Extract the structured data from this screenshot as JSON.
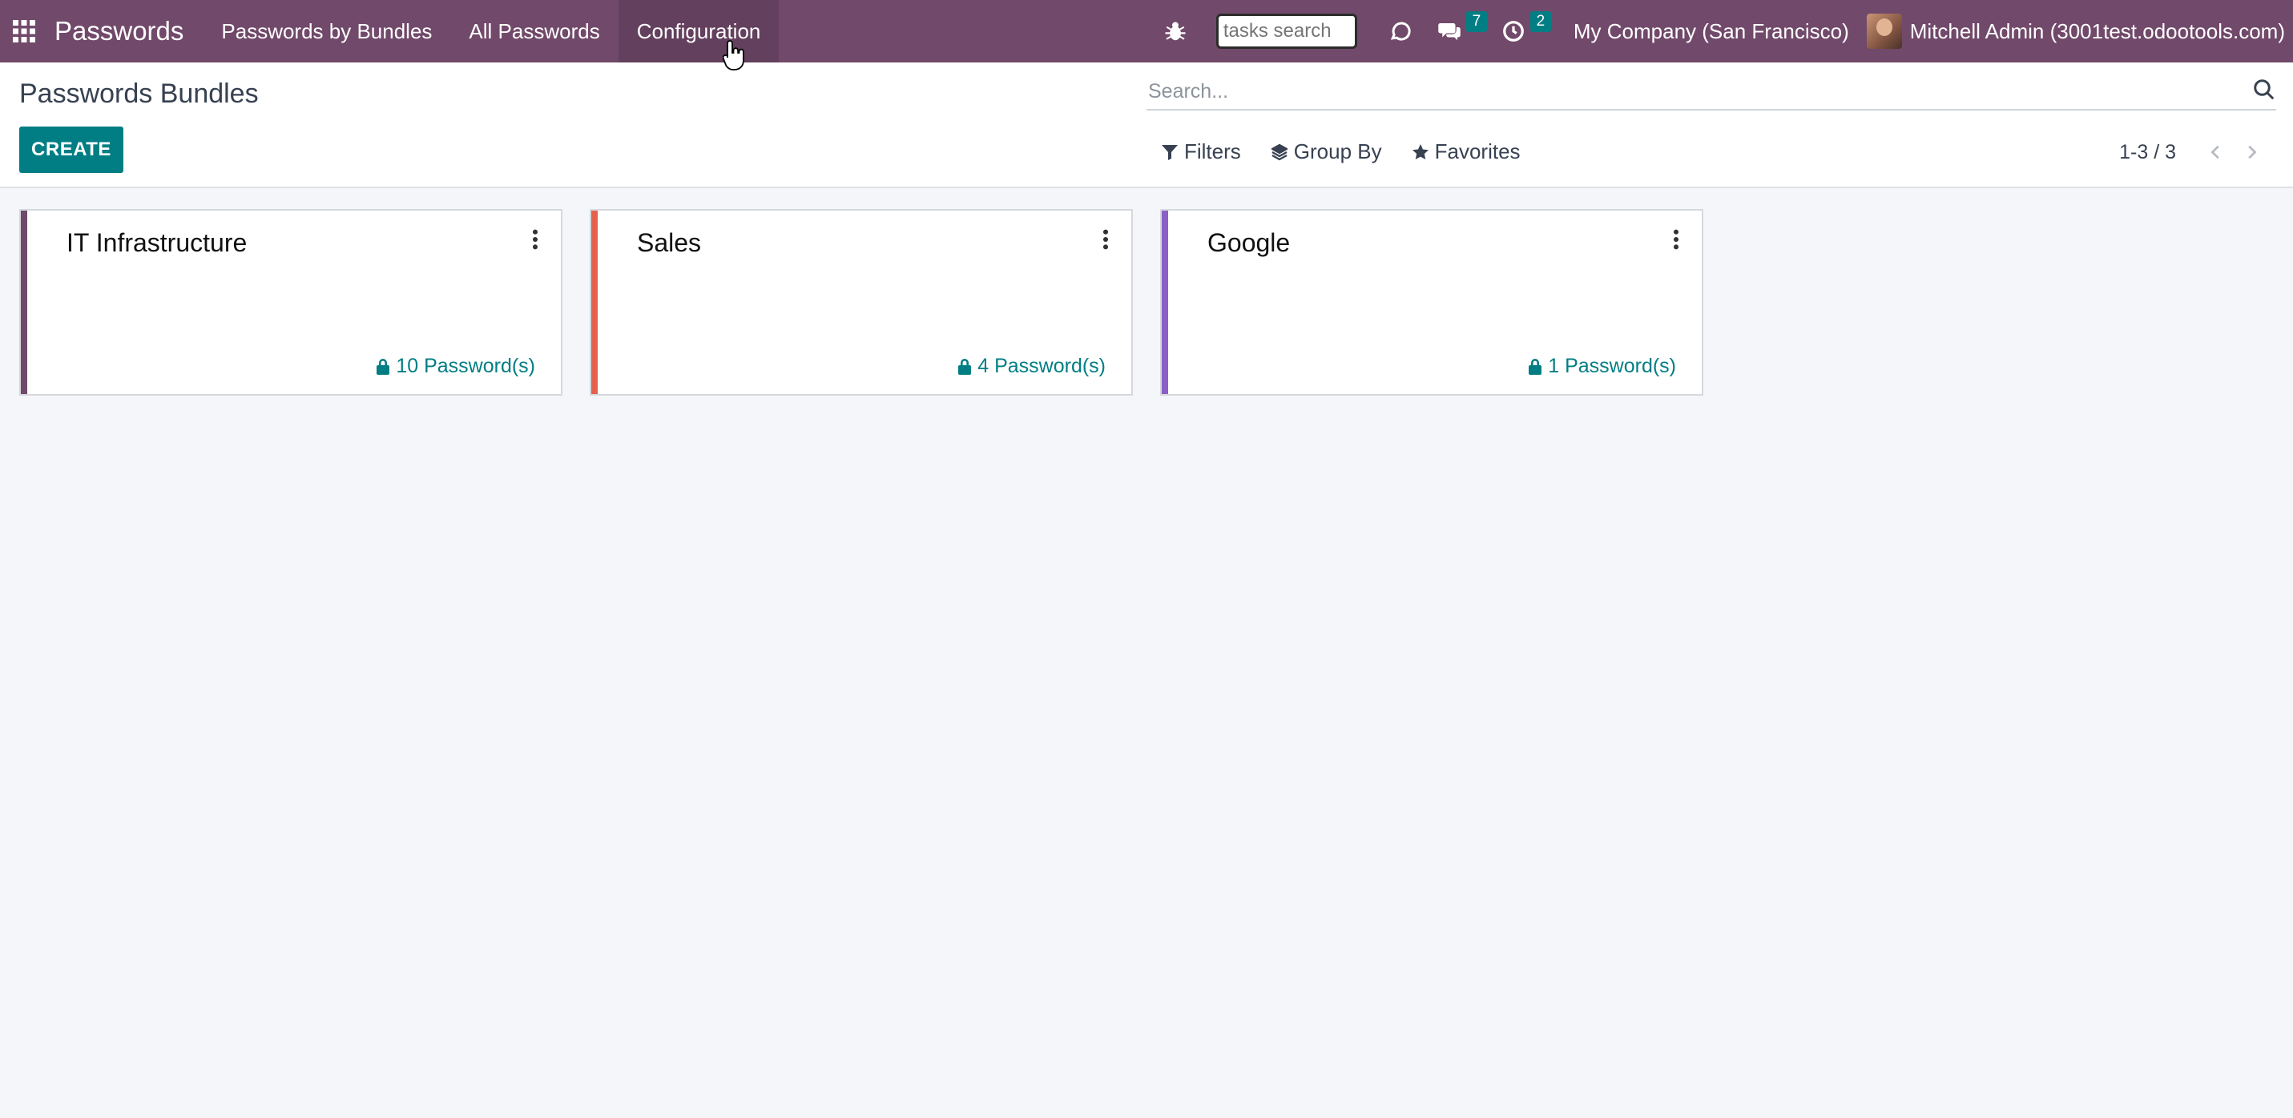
{
  "navbar": {
    "brand": "Passwords",
    "menu": [
      {
        "label": "Passwords by Bundles"
      },
      {
        "label": "All Passwords"
      },
      {
        "label": "Configuration"
      }
    ],
    "tasks_search_placeholder": "tasks search",
    "messages_badge": "7",
    "activities_badge": "2",
    "company": "My Company (San Francisco)",
    "user": "Mitchell Admin (3001test.odootools.com)"
  },
  "control_panel": {
    "title": "Passwords Bundles",
    "create_label": "CREATE",
    "search_placeholder": "Search...",
    "filters_label": "Filters",
    "group_by_label": "Group By",
    "favorites_label": "Favorites",
    "pager": "1-3 / 3"
  },
  "cards": [
    {
      "title": "IT Infrastructure",
      "count": "10 Password(s)",
      "color": "#71496a"
    },
    {
      "title": "Sales",
      "count": "4 Password(s)",
      "color": "#e5604d"
    },
    {
      "title": "Google",
      "count": "1 Password(s)",
      "color": "#8c5fc6"
    }
  ],
  "colors": {
    "navbar": "#71496a",
    "primary": "#017e84"
  }
}
